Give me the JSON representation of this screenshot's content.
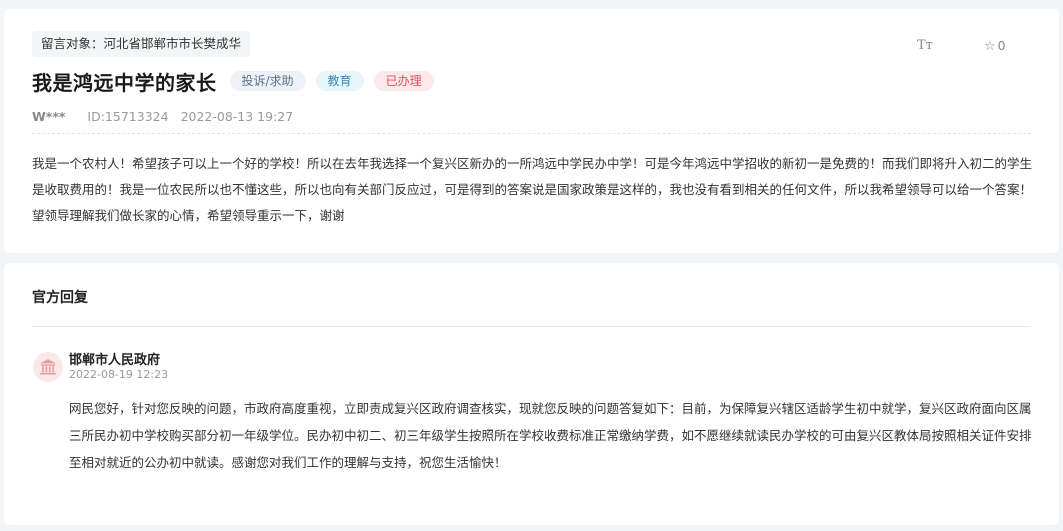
{
  "message": {
    "target_label": "留言对象：",
    "target": "河北省邯郸市市长樊成华",
    "title": "我是鸿远中学的家长",
    "tags": {
      "type": "投诉/求助",
      "field": "教育",
      "status": "已办理"
    },
    "author": "W***",
    "id": "ID:15713324",
    "datetime": "2022-08-13 19:27",
    "content": "我是一个农村人！希望孩子可以上一个好的学校！所以在去年我选择一个复兴区新办的一所鸿远中学民办中学！可是今年鸿远中学招收的新初一是免费的！而我们即将升入初二的学生是收取费用的！我是一位农民所以也不懂这些，所以也向有关部门反应过，可是得到的答案说是国家政策是这样的，我也没有看到相关的任何文件，所以我希望领导可以给一个答案！ 望领导理解我们做长家的心情，希望领导重示一下，谢谢"
  },
  "toolbar": {
    "font_icon_text": "Tт",
    "favorite_count": "0",
    "font_icon": "font-size-icon",
    "favorite_icon": "star-outline-icon"
  },
  "reply": {
    "section_title": "官方回复",
    "org_icon": "government-building-icon",
    "org_name": "邯郸市人民政府",
    "date": "2022-08-19 12:23",
    "content": "网民您好，针对您反映的问题，市政府高度重视，立即责成复兴区政府调查核实，现就您反映的问题答复如下：目前，为保障复兴辖区适龄学生初中就学，复兴区政府面向区属三所民办初中学校购买部分初一年级学位。民办初中初二、初三年级学生按照所在学校收费标准正常缴纳学费，如不愿继续就读民办学校的可由复兴区教体局按照相关证件安排至相对就近的公办初中就读。感谢您对我们工作的理解与支持，祝您生活愉快！"
  },
  "colors": {
    "status_red": "#e0505e",
    "field_blue": "#3a8bb5",
    "type_slate": "#5b7190",
    "avatar_bg": "#fbe9ea",
    "avatar_icon": "#e8a0a3"
  }
}
